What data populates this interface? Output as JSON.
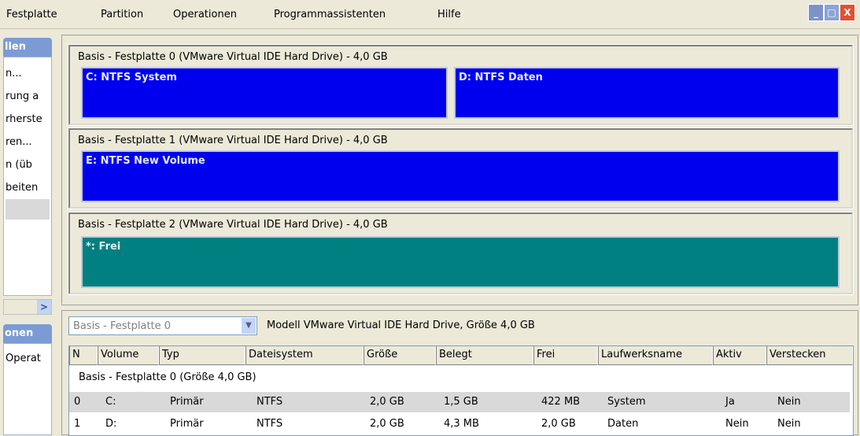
{
  "menu": {
    "items": [
      "Festplatte",
      "Partition",
      "Operationen",
      "Programmassistenten",
      "Hilfe"
    ]
  },
  "window_buttons": {
    "minimize": "_",
    "maximize": "□",
    "close": "X"
  },
  "sidebar": {
    "head1": "llen",
    "items": [
      "n...",
      "rung a",
      "rherste",
      "ren...",
      "n (üb",
      "beiten"
    ],
    "scroll_arrow": ">",
    "head2": "onen",
    "bottom_item": "Operat"
  },
  "disks": [
    {
      "label": "Basis -  Festplatte 0 (VMware Virtual IDE Hard Drive) - 4,0 GB",
      "partitions": [
        {
          "label": "C: NTFS System",
          "type": "ntfs"
        },
        {
          "label": "D: NTFS Daten",
          "type": "ntfs"
        }
      ]
    },
    {
      "label": "Basis -  Festplatte 1 (VMware Virtual IDE Hard Drive) - 4,0 GB",
      "partitions": [
        {
          "label": "E: NTFS New Volume",
          "type": "ntfs"
        }
      ]
    },
    {
      "label": "Basis -  Festplatte 2 (VMware Virtual IDE Hard Drive) - 4,0 GB",
      "partitions": [
        {
          "label": "*: Frei",
          "type": "free"
        }
      ]
    }
  ],
  "bottom": {
    "combo_value": "Basis - Festplatte 0",
    "model_text": "Modell VMware Virtual IDE Hard Drive, Größe 4,0 GB",
    "columns": [
      "N",
      "Volume",
      "Typ",
      "Dateisystem",
      "Größe",
      "Belegt",
      "Frei",
      "Laufwerksname",
      "Aktiv",
      "Verstecken"
    ],
    "group_title": "Basis -  Festplatte 0 (Größe 4,0 GB)",
    "rows": [
      [
        "0",
        "C:",
        "Primär",
        "NTFS",
        "2,0 GB",
        "1,5 GB",
        "422 MB",
        "System",
        "Ja",
        "Nein"
      ],
      [
        "1",
        "D:",
        "Primär",
        "NTFS",
        "2,0 GB",
        "4,3 MB",
        "2,0 GB",
        "Daten",
        "Nein",
        "Nein"
      ]
    ]
  },
  "colors": {
    "ntfs": "#0000ee",
    "free": "#008080",
    "sidebar_head": "#7c9bd5",
    "background": "#ece9d8"
  }
}
